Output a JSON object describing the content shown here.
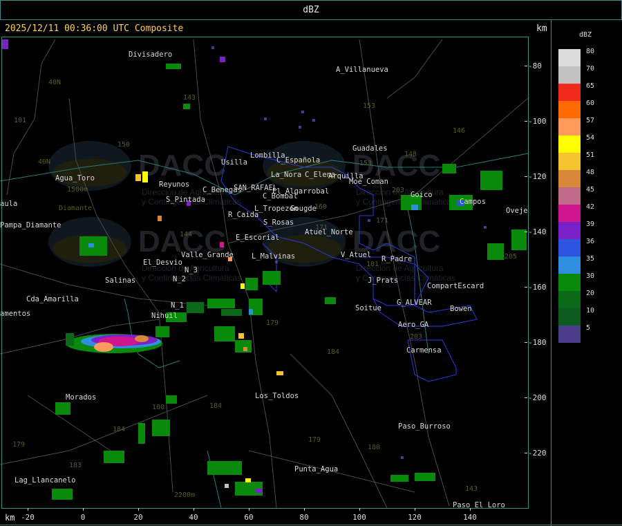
{
  "window": {
    "title": "dBZ"
  },
  "header": {
    "label": "2025/12/11 00:36:00 UTC Composite",
    "unit_top": "km",
    "unit_bottom": "km"
  },
  "legend": {
    "title": "dBZ",
    "items": [
      {
        "value": "80",
        "color": "#dcdcdc"
      },
      {
        "value": "70",
        "color": "#c2c2c2"
      },
      {
        "value": "65",
        "color": "#f02a1a"
      },
      {
        "value": "60",
        "color": "#ff6a00"
      },
      {
        "value": "57",
        "color": "#ff9a5a"
      },
      {
        "value": "54",
        "color": "#ffff00"
      },
      {
        "value": "51",
        "color": "#f5c330"
      },
      {
        "value": "48",
        "color": "#d8883a"
      },
      {
        "value": "45",
        "color": "#c26a8a"
      },
      {
        "value": "42",
        "color": "#d0168f"
      },
      {
        "value": "39",
        "color": "#7a22c8"
      },
      {
        "value": "36",
        "color": "#2e55e0"
      },
      {
        "value": "35",
        "color": "#2e8ee0"
      },
      {
        "value": "30",
        "color": "#0a8a0a"
      },
      {
        "value": "20",
        "color": "#0a6a1a"
      },
      {
        "value": "10",
        "color": "#0d5a1e"
      },
      {
        "value": "5",
        "color": "#4a3a8a"
      }
    ]
  },
  "axes": {
    "y_ticks": [
      "-80",
      "-100",
      "-120",
      "-140",
      "-160",
      "-180",
      "-200",
      "-220"
    ],
    "x_ticks": [
      "-20",
      "0",
      "20",
      "40",
      "60",
      "80",
      "100",
      "120",
      "140"
    ]
  },
  "places": [
    {
      "name": "Divisadero"
    },
    {
      "name": "A_Villanueva"
    },
    {
      "name": "Guadales"
    },
    {
      "name": "Agua_Toro"
    },
    {
      "name": "aula"
    },
    {
      "name": "Pampa_Diamante"
    },
    {
      "name": "Reyunos"
    },
    {
      "name": "S_Pintada"
    },
    {
      "name": "Usilla"
    },
    {
      "name": "Lombilla"
    },
    {
      "name": "C_Española"
    },
    {
      "name": "La_Nora"
    },
    {
      "name": "C_Elena"
    },
    {
      "name": "Arquilla"
    },
    {
      "name": "Moe_Coman"
    },
    {
      "name": "Goico"
    },
    {
      "name": "Campos"
    },
    {
      "name": "Oveje"
    },
    {
      "name": "SAN_RAFAEL"
    },
    {
      "name": "C_Benegas"
    },
    {
      "name": "El_Algarrobal"
    },
    {
      "name": "C_Bombal"
    },
    {
      "name": "L_Tropezon"
    },
    {
      "name": "Gougde"
    },
    {
      "name": "R_Caida"
    },
    {
      "name": "S_Rosas"
    },
    {
      "name": "Atuel_Norte"
    },
    {
      "name": "E_Escorial"
    },
    {
      "name": "Valle_Grande"
    },
    {
      "name": "L_Malvinas"
    },
    {
      "name": "V_Atuel"
    },
    {
      "name": "R_Padre"
    },
    {
      "name": "El_Desvio"
    },
    {
      "name": "Salinas"
    },
    {
      "name": "N_2"
    },
    {
      "name": "N_3"
    },
    {
      "name": "N_1"
    },
    {
      "name": "Cda_Amarilla"
    },
    {
      "name": "amentos"
    },
    {
      "name": "Nihuil"
    },
    {
      "name": "J_Prats"
    },
    {
      "name": "CompartEscard"
    },
    {
      "name": "G_ALVEAR"
    },
    {
      "name": "Soitue"
    },
    {
      "name": "Bowen"
    },
    {
      "name": "Aero_GA"
    },
    {
      "name": "Carmensa"
    },
    {
      "name": "Morados"
    },
    {
      "name": "Los_Toldos"
    },
    {
      "name": "Paso_Burroso"
    },
    {
      "name": "Punta_Agua"
    },
    {
      "name": "Lag_Llancanelo"
    },
    {
      "name": "Paso_El_Loro"
    },
    {
      "name": "La_Nora"
    }
  ],
  "contour_labels": [
    "101",
    "40N",
    "40N",
    "143",
    "153",
    "146",
    "148",
    "150",
    "153",
    "203",
    "171",
    "144",
    "160",
    "171",
    "181",
    "179",
    "203",
    "184",
    "205",
    "179",
    "184",
    "180",
    "184",
    "183",
    "179",
    "180",
    "143",
    "1500m",
    "2200m",
    "Diamante"
  ],
  "watermark": {
    "brand": "DACC",
    "line1": "Dirección de Agricultura",
    "line2": "y Contingencias Climáticas"
  }
}
